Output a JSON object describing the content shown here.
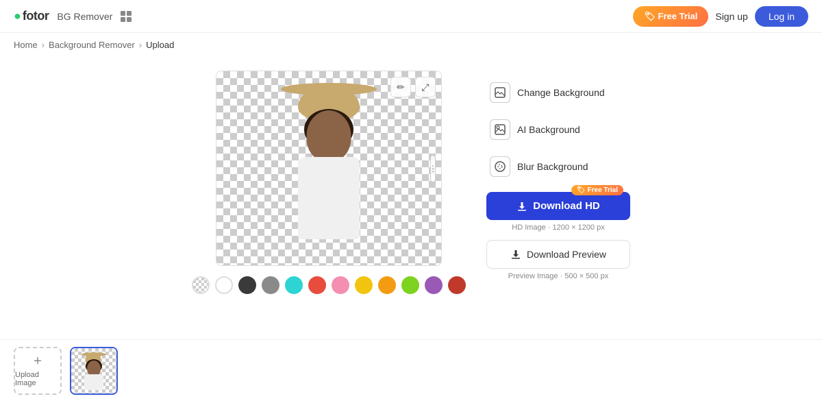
{
  "header": {
    "logo": "fotor",
    "logo_accent": "o",
    "app_name": "BG Remover",
    "free_trial_label": "🏷 Free Trial",
    "signup_label": "Sign up",
    "login_label": "Log in"
  },
  "breadcrumb": {
    "home": "Home",
    "bg_remover": "Background Remover",
    "current": "Upload"
  },
  "tools": {
    "edit_icon": "✏",
    "expand_icon": "⤢"
  },
  "colors": [
    {
      "name": "checker",
      "value": "checker"
    },
    {
      "name": "white",
      "value": "#ffffff"
    },
    {
      "name": "black",
      "value": "#3a3a3a"
    },
    {
      "name": "gray",
      "value": "#8a8a8a"
    },
    {
      "name": "cyan",
      "value": "#2dd4d4"
    },
    {
      "name": "red",
      "value": "#e74c3c"
    },
    {
      "name": "pink",
      "value": "#f48fb1"
    },
    {
      "name": "yellow",
      "value": "#f1c40f"
    },
    {
      "name": "orange",
      "value": "#f39c12"
    },
    {
      "name": "green",
      "value": "#7ed321"
    },
    {
      "name": "purple",
      "value": "#9b59b6"
    },
    {
      "name": "dark-red",
      "value": "#c0392b"
    }
  ],
  "panel": {
    "change_bg_label": "Change Background",
    "ai_bg_label": "AI Background",
    "blur_bg_label": "Blur Background"
  },
  "download": {
    "hd_label": "Download HD",
    "hd_badge": "🏷 Free Trial",
    "hd_info": "HD Image · 1200 × 1200 px",
    "preview_label": "Download Preview",
    "preview_info": "Preview Image · 500 × 500 px"
  },
  "bottom": {
    "upload_plus": "+",
    "upload_label": "Upload Image"
  }
}
